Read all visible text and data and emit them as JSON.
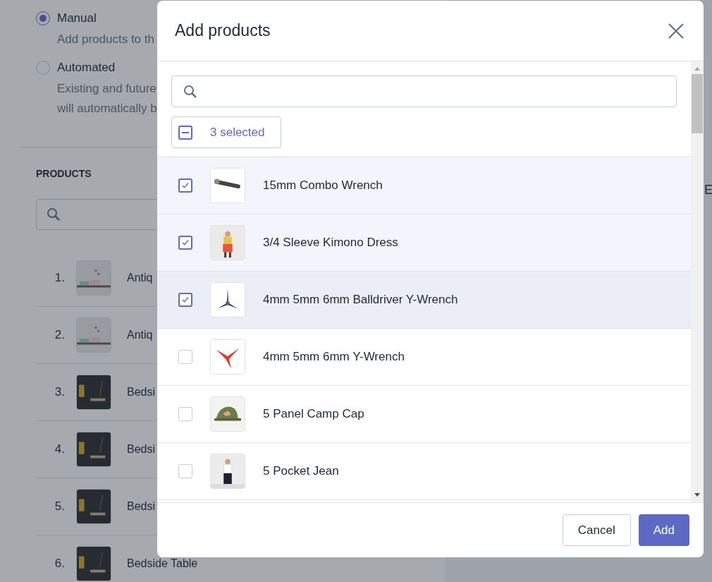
{
  "background": {
    "collection_type": [
      {
        "label": "Manual",
        "description": [
          "Add products to th"
        ],
        "selected": true
      },
      {
        "label": "Automated",
        "description": [
          "Existing and future",
          "will automatically b"
        ],
        "selected": false
      }
    ],
    "products_heading": "PRODUCTS",
    "products": [
      {
        "number": "1.",
        "name": "Antiq"
      },
      {
        "number": "2.",
        "name": "Antiq"
      },
      {
        "number": "3.",
        "name": "Bedsi"
      },
      {
        "number": "4.",
        "name": "Bedsi"
      },
      {
        "number": "5.",
        "name": "Bedsi"
      },
      {
        "number": "6.",
        "name": "Bedside Table"
      }
    ],
    "side_text": "E"
  },
  "modal": {
    "title": "Add products",
    "bulk_select": {
      "label": "3 selected"
    },
    "products": [
      {
        "name": "15mm Combo Wrench",
        "checked": true,
        "hovered": false
      },
      {
        "name": "3/4 Sleeve Kimono Dress",
        "checked": true,
        "hovered": false
      },
      {
        "name": "4mm 5mm 6mm Balldriver Y-Wrench",
        "checked": true,
        "hovered": true
      },
      {
        "name": "4mm 5mm 6mm Y-Wrench",
        "checked": false,
        "hovered": false
      },
      {
        "name": "5 Panel Camp Cap",
        "checked": false,
        "hovered": false
      },
      {
        "name": "5 Pocket Jean",
        "checked": false,
        "hovered": false
      }
    ],
    "buttons": [
      {
        "label": "Cancel",
        "kind": "secondary"
      },
      {
        "label": "Add",
        "kind": "primary"
      }
    ]
  }
}
